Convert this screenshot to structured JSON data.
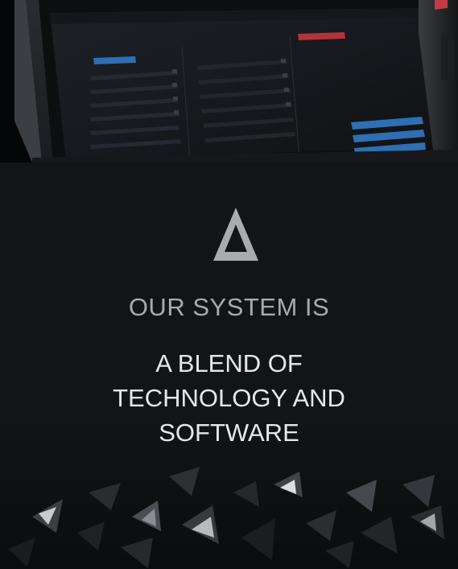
{
  "hero": {
    "image_label": "touchscreen-console-photo"
  },
  "logo": {
    "icon": "triangle-logo-icon",
    "color": "#a9abad"
  },
  "eyebrow": "OUR SYSTEM IS",
  "headline": {
    "line1": "A BLEND OF",
    "line2": "TECHNOLOGY AND",
    "line3": "SOFTWARE"
  },
  "colors": {
    "background": "#121416",
    "eyebrow_text": "#a8aaac",
    "headline_text": "#e6e7e8",
    "screen_accent_blue": "#2f6fb3",
    "screen_accent_red": "#b3333a"
  }
}
